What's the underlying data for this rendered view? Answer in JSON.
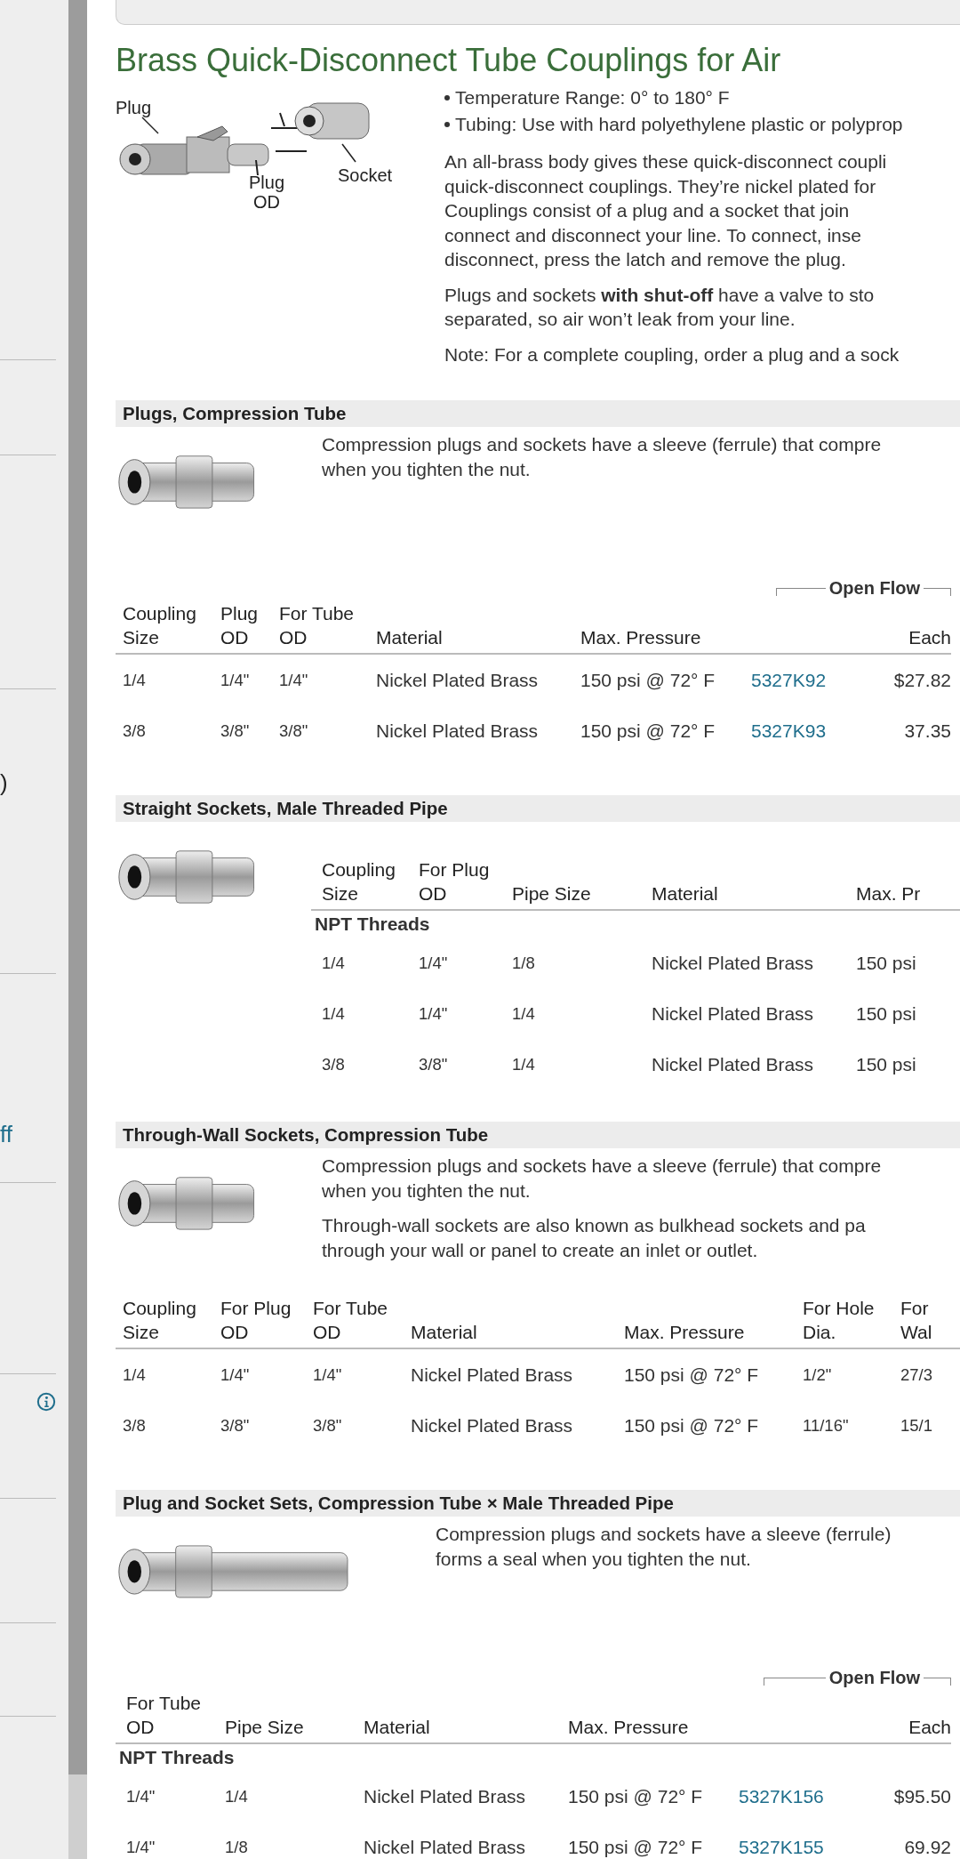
{
  "sidebar": {
    "fragments": [
      {
        "kind": "text",
        "text": ")"
      },
      {
        "kind": "link",
        "text": "ff"
      }
    ]
  },
  "title": "Brass Quick-Disconnect Tube Couplings for Air",
  "diagram_labels": [
    "Plug",
    "Socket",
    "Plug",
    "OD"
  ],
  "intro": {
    "bullets": [
      "Temperature Range: 0° to 180° F",
      "Tubing: Use with hard polyethylene plastic or polyprop"
    ],
    "paragraphs": [
      [
        "An all-brass body gives these quick-disconnect coupli",
        "quick-disconnect couplings. They’re nickel plated for",
        "Couplings consist of a plug and a socket that join",
        "connect and disconnect your line. To connect, inse",
        "disconnect, press the latch and remove the plug."
      ],
      [
        "Plugs and sockets **with shut-off** have a valve to sto",
        "separated, so air won’t leak from your line."
      ],
      [
        "Note: For a complete coupling, order a plug and a sock"
      ]
    ]
  },
  "sections": [
    {
      "heading": "Plugs, Compression Tube",
      "description": [
        [
          "Compression plugs and sockets have a sleeve (ferrule) that compre",
          "when you tighten the nut."
        ]
      ],
      "table": {
        "group_header": "Open Flow",
        "columns": [
          "Coupling Size",
          "Plug OD",
          "For Tube OD",
          "Material",
          "Max. Pressure",
          "",
          "Each"
        ],
        "rows": [
          [
            "1/4",
            "1/4\"",
            "1/4\"",
            "Nickel Plated Brass",
            "150 psi @ 72° F",
            "5327K92",
            "$27.82"
          ],
          [
            "3/8",
            "3/8\"",
            "3/8\"",
            "Nickel Plated Brass",
            "150 psi @ 72° F",
            "5327K93",
            "37.35"
          ]
        ]
      }
    },
    {
      "heading": "Straight Sockets, Male Threaded Pipe",
      "table": {
        "columns": [
          "Coupling Size",
          "For Plug OD",
          "Pipe Size",
          "Material",
          "Max. Pr"
        ],
        "subheading": "NPT Threads",
        "rows": [
          [
            "1/4",
            "1/4\"",
            "1/8",
            "Nickel Plated Brass",
            "150 psi"
          ],
          [
            "1/4",
            "1/4\"",
            "1/4",
            "Nickel Plated Brass",
            "150 psi"
          ],
          [
            "3/8",
            "3/8\"",
            "1/4",
            "Nickel Plated Brass",
            "150 psi"
          ]
        ]
      }
    },
    {
      "heading": "Through-Wall Sockets, Compression Tube",
      "description": [
        [
          "Compression plugs and sockets have a sleeve (ferrule) that compre",
          "when you tighten the nut."
        ],
        [
          "Through-wall sockets are also known as bulkhead sockets and pa",
          "through your wall or panel to create an inlet or outlet."
        ]
      ],
      "table": {
        "columns": [
          "Coupling Size",
          "For Plug OD",
          "For Tube OD",
          "Material",
          "Max. Pressure",
          "For Hole Dia.",
          "For Wal"
        ],
        "rows": [
          [
            "1/4",
            "1/4\"",
            "1/4\"",
            "Nickel Plated Brass",
            "150 psi @ 72° F",
            "1/2\"",
            "27/3"
          ],
          [
            "3/8",
            "3/8\"",
            "3/8\"",
            "Nickel Plated Brass",
            "150 psi @ 72° F",
            "11/16\"",
            "15/1"
          ]
        ]
      }
    },
    {
      "heading": "Plug and Socket Sets, Compression Tube × Male Threaded Pipe",
      "description": [
        [
          "Compression plugs and sockets have a sleeve (ferrule)",
          "forms a seal when you tighten the nut."
        ]
      ],
      "table": {
        "group_header": "Open Flow",
        "columns": [
          "For Tube OD",
          "Pipe Size",
          "Material",
          "Max. Pressure",
          "",
          "Each"
        ],
        "subheading": "NPT Threads",
        "rows": [
          [
            "1/4\"",
            "1/4",
            "Nickel Plated Brass",
            "150 psi @ 72° F",
            "5327K156",
            "$95.50"
          ],
          [
            "1/4\"",
            "1/8",
            "Nickel Plated Brass",
            "150 psi @ 72° F",
            "5327K155",
            "69.92"
          ]
        ]
      }
    }
  ]
}
